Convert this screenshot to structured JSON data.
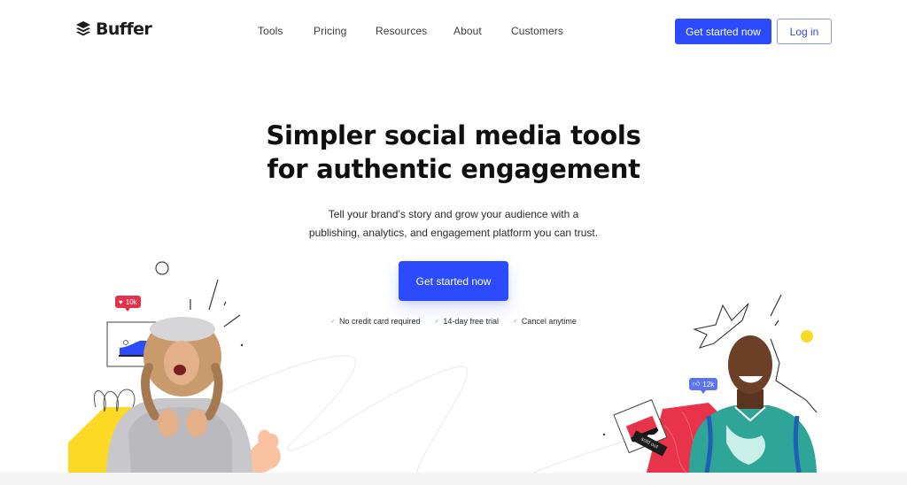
{
  "brand": {
    "name": "Buffer",
    "logo_icon": "layers-stack-icon",
    "accent_color": "#2c4bff"
  },
  "nav": {
    "items": [
      {
        "label": "Tools"
      },
      {
        "label": "Pricing"
      },
      {
        "label": "Resources"
      },
      {
        "label": "About"
      },
      {
        "label": "Customers"
      }
    ]
  },
  "header_actions": {
    "get_started_label": "Get started now",
    "login_label": "Log in"
  },
  "hero": {
    "title_line1": "Simpler social media tools",
    "title_line2": "for authentic engagement",
    "subtitle_line1": "Tell your brand’s story and grow your audience with a",
    "subtitle_line2": "publishing, analytics, and engagement platform you can trust.",
    "cta_label": "Get started now",
    "perks": [
      {
        "icon": "check-icon",
        "label": "No credit card required"
      },
      {
        "icon": "check-icon",
        "label": "14-day free trial"
      },
      {
        "icon": "check-icon",
        "label": "Cancel anytime"
      }
    ]
  },
  "illustrations": {
    "left": {
      "badge_icon": "heart-icon",
      "badge_label": "10k",
      "badge_color": "#e0324a",
      "product_card": "blue-sneaker"
    },
    "right": {
      "badge_icon": "thumbs-up-icon",
      "badge_label": "12k",
      "badge_color": "#5b74f0",
      "product_card": "red-shoe",
      "tag_label": "sold out"
    }
  }
}
